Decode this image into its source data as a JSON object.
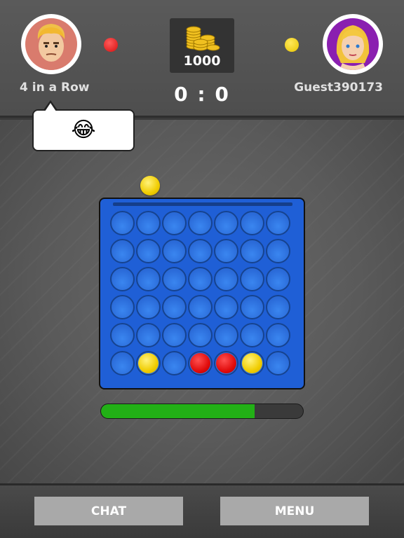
{
  "players": {
    "left": {
      "name": "4 in a Row",
      "avatar": "male-avatar",
      "color": "#e01010"
    },
    "right": {
      "name": "Guest390173",
      "avatar": "female-avatar",
      "color": "#f0cc00"
    }
  },
  "pot": {
    "amount": "1000",
    "icon": "gold-coins-icon"
  },
  "score": "0 : 0",
  "chat_bubble": {
    "emoji": "😂"
  },
  "board": {
    "columns": 7,
    "rows": 6,
    "cells": [
      [
        "empty",
        "empty",
        "empty",
        "empty",
        "empty",
        "empty",
        "empty"
      ],
      [
        "empty",
        "empty",
        "empty",
        "empty",
        "empty",
        "empty",
        "empty"
      ],
      [
        "empty",
        "empty",
        "empty",
        "empty",
        "empty",
        "empty",
        "empty"
      ],
      [
        "empty",
        "empty",
        "empty",
        "empty",
        "empty",
        "empty",
        "empty"
      ],
      [
        "empty",
        "empty",
        "empty",
        "empty",
        "empty",
        "empty",
        "empty"
      ],
      [
        "empty",
        "yellow",
        "empty",
        "red",
        "red",
        "yellow",
        "empty"
      ]
    ],
    "next_piece": "yellow"
  },
  "timer_progress": 0.76,
  "buttons": {
    "chat": "CHAT",
    "menu": "MENU"
  }
}
